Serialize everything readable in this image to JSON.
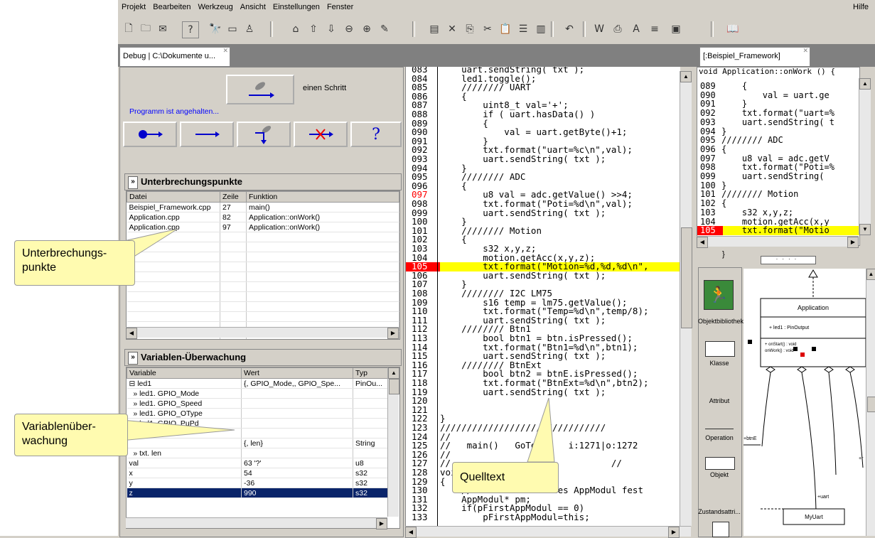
{
  "menu": {
    "items": [
      "Projekt",
      "Bearbeiten",
      "Werkzeug",
      "Ansicht",
      "Einstellungen",
      "Fenster"
    ],
    "help": "Hilfe"
  },
  "toolbar": {
    "icons": [
      "new-icon",
      "open-icon",
      "mail-icon",
      "help-icon",
      "find-icon",
      "window-icon",
      "user-icon",
      "home-icon",
      "up-icon",
      "down-icon",
      "zoom-out-icon",
      "zoom-in-icon",
      "edit-icon",
      "note-icon",
      "delete-icon",
      "copy-icon",
      "cut-icon",
      "paste-icon",
      "list-icon",
      "columns-icon",
      "undo-icon",
      "word-icon",
      "print-icon",
      "font-icon",
      "align-icon",
      "window2-icon",
      "book-icon"
    ]
  },
  "tabs": {
    "debug": "Debug | C:\\Dokumente u...",
    "framework": "[:Beispiel_Framework]"
  },
  "debug": {
    "step_label": "einen Schritt",
    "status": "Programm ist angehalten...",
    "help_glyph": "?"
  },
  "breakpoints": {
    "title": "Unterbrechungspunkte",
    "columns": [
      "Datei",
      "Zeile",
      "Funktion"
    ],
    "rows": [
      [
        "Beispiel_Framework.cpp",
        "27",
        "main()"
      ],
      [
        "Application.cpp",
        "82",
        "Application::onWork()"
      ],
      [
        "Application.cpp",
        "97",
        "Application::onWork()"
      ]
    ]
  },
  "watch": {
    "title": "Variablen-Überwachung",
    "columns": [
      "Variable",
      "Wert",
      "Typ"
    ],
    "rows": [
      [
        "⊟ led1",
        "{, GPIO_Mode,, GPIO_Spe...",
        "PinOu..."
      ],
      [
        "  » led1. GPIO_Mode",
        "",
        ""
      ],
      [
        "  » led1. GPIO_Speed",
        "",
        ""
      ],
      [
        "  » led1. GPIO_OType",
        "",
        ""
      ],
      [
        "  » led1. GPIO_PuPd",
        "",
        ""
      ],
      [
        "  » led1. gpio",
        "",
        ""
      ],
      [
        "",
        "{, len}",
        "String"
      ],
      [
        "  » txt. len",
        "",
        ""
      ],
      [
        "val",
        "63 '?'",
        "u8"
      ],
      [
        "x",
        "54",
        "s32"
      ],
      [
        "y",
        "-36",
        "s32"
      ],
      [
        "z",
        "990",
        "s32"
      ]
    ]
  },
  "code_main": {
    "lines": [
      [
        "083",
        "    uart.sendString( txt );"
      ],
      [
        "084",
        "    led1.toggle();"
      ],
      [
        "085",
        "    //////// UART"
      ],
      [
        "086",
        "    {"
      ],
      [
        "087",
        "        uint8_t val='+';"
      ],
      [
        "088",
        "        if ( uart.hasData() )"
      ],
      [
        "089",
        "        {"
      ],
      [
        "090",
        "            val = uart.getByte()+1;"
      ],
      [
        "091",
        "        }"
      ],
      [
        "092",
        "        txt.format(\"uart=%c\\n\",val);"
      ],
      [
        "093",
        "        uart.sendString( txt );"
      ],
      [
        "094",
        "    }"
      ],
      [
        "095",
        "    //////// ADC"
      ],
      [
        "096",
        "    {"
      ],
      [
        "097",
        "        u8 val = adc.getValue() >>4;"
      ],
      [
        "098",
        "        txt.format(\"Poti=%d\\n\",val);"
      ],
      [
        "099",
        "        uart.sendString( txt );"
      ],
      [
        "100",
        "    }"
      ],
      [
        "101",
        "    //////// Motion"
      ],
      [
        "102",
        "    {"
      ],
      [
        "103",
        "        s32 x,y,z;"
      ],
      [
        "104",
        "        motion.getAcc(x,y,z);"
      ],
      [
        "105",
        "        txt.format(\"Motion=%d,%d,%d\\n\","
      ],
      [
        "106",
        "        uart.sendString( txt );"
      ],
      [
        "107",
        "    }"
      ],
      [
        "108",
        "    //////// I2C LM75"
      ],
      [
        "109",
        "        s16 temp = lm75.getValue();"
      ],
      [
        "110",
        "        txt.format(\"Temp=%d\\n\",temp/8);"
      ],
      [
        "111",
        "        uart.sendString( txt );"
      ],
      [
        "112",
        "    //////// Btn1"
      ],
      [
        "113",
        "        bool btn1 = btn.isPressed();"
      ],
      [
        "114",
        "        txt.format(\"Btn1=%d\\n\",btn1);"
      ],
      [
        "115",
        "        uart.sendString( txt );"
      ],
      [
        "116",
        "    //////// BtnExt"
      ],
      [
        "117",
        "        bool btn2 = btnE.isPressed();"
      ],
      [
        "118",
        "        txt.format(\"BtnExt=%d\\n\",btn2);"
      ],
      [
        "119",
        "        uart.sendString( txt );"
      ],
      [
        "120",
        ""
      ],
      [
        "121",
        ""
      ],
      [
        "122",
        "}"
      ],
      [
        "123",
        "///////////////////////////////"
      ],
      [
        "124",
        "//"
      ],
      [
        "125",
        "//   main()   GoToSrc   i:1271|o:1272"
      ],
      [
        "126",
        "//"
      ],
      [
        "127",
        "//                              //"
      ],
      [
        "128",
        "void"
      ],
      [
        "129",
        "{"
      ],
      [
        "130",
        "    // selbst als erstes AppModul fest"
      ],
      [
        "131",
        "    AppModul* pm;"
      ],
      [
        "132",
        "    if(pFirstAppModul == 0)"
      ],
      [
        "133",
        "        pFirstAppModul=this;"
      ]
    ]
  },
  "code_side": {
    "header": "void Application::onWork () {",
    "lines": [
      [
        "089",
        "    {"
      ],
      [
        "090",
        "        val = uart.ge"
      ],
      [
        "091",
        "    }"
      ],
      [
        "092",
        "    txt.format(\"uart=%"
      ],
      [
        "093",
        "    uart.sendString( t"
      ],
      [
        "094",
        "}"
      ],
      [
        "095",
        "//////// ADC"
      ],
      [
        "096",
        "{"
      ],
      [
        "097",
        "    u8 val = adc.getV"
      ],
      [
        "098",
        "    txt.format(\"Poti=%"
      ],
      [
        "099",
        "    uart.sendString("
      ],
      [
        "100",
        "}"
      ],
      [
        "101",
        "//////// Motion"
      ],
      [
        "102",
        "{"
      ],
      [
        "103",
        "    s32 x,y,z;"
      ],
      [
        "104",
        "    motion.getAcc(x,y"
      ],
      [
        "105",
        "    txt.format(\"Motio"
      ]
    ]
  },
  "palette": {
    "items": [
      "Objektbibliothek",
      "Klasse",
      "Attribut",
      "Operation",
      "Objekt",
      "Zustandsattri..."
    ]
  },
  "uml": {
    "class_name": "Application",
    "attr": "+ led1 : PinOutput",
    "ops1": "+ onStart() : void",
    "ops2": "onWork() : void",
    "label_btne": "+btnE",
    "label_uart": "+uart",
    "label_r": "+r",
    "myuart": "MyUart",
    "brace": "}"
  },
  "callouts": {
    "breakpoints": "Unterbrechungs-\npunkte",
    "watch": "Variablenüber-\nwachung",
    "source": "Quelltext"
  },
  "colors": {
    "breakpoint_line": "#ff0000",
    "current_line": "#ffff00",
    "comment": "#000000",
    "string": "#000000",
    "selected_row": "#0a246a",
    "status_text": "#0000ff"
  }
}
